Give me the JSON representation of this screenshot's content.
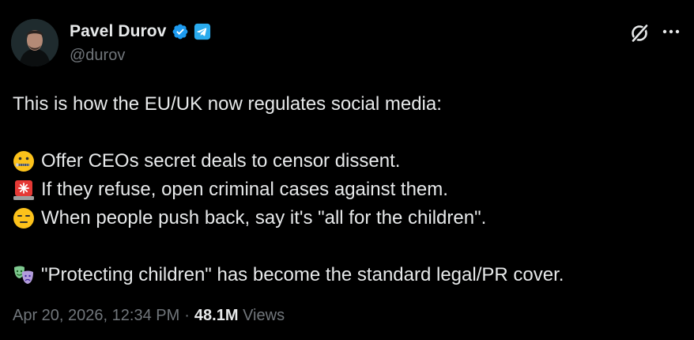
{
  "author": {
    "display_name": "Pavel Durov",
    "handle": "@durov",
    "avatar_icon": "avatar-photo",
    "verified_icon": "verified-badge-icon",
    "affiliation_icon": "telegram-icon"
  },
  "actions": {
    "grok_icon": "grok-icon",
    "more_icon": "more-icon"
  },
  "tweet": {
    "lines": [
      "This is how the EU/UK now regulates social media:",
      "Offer CEOs secret deals to censor dissent.",
      "If they refuse, open criminal cases against them.",
      "When people push back, say it's \"all for the children\".",
      "\"Protecting children\" has become the standard legal/PR cover."
    ],
    "emojis": [
      "zipper-mouth-face-emoji",
      "police-light-emoji",
      "expressionless-face-emoji",
      "performing-arts-emoji"
    ]
  },
  "meta": {
    "timestamp": "Apr 20, 2026, 12:34 PM",
    "separator": "·",
    "views_count": "48.1M",
    "views_label": "Views"
  },
  "colors": {
    "background": "#000000",
    "text_primary": "#e7e9ea",
    "text_secondary": "#71767b",
    "verified_blue": "#1d9bf0",
    "telegram_blue": "#2aabee"
  }
}
